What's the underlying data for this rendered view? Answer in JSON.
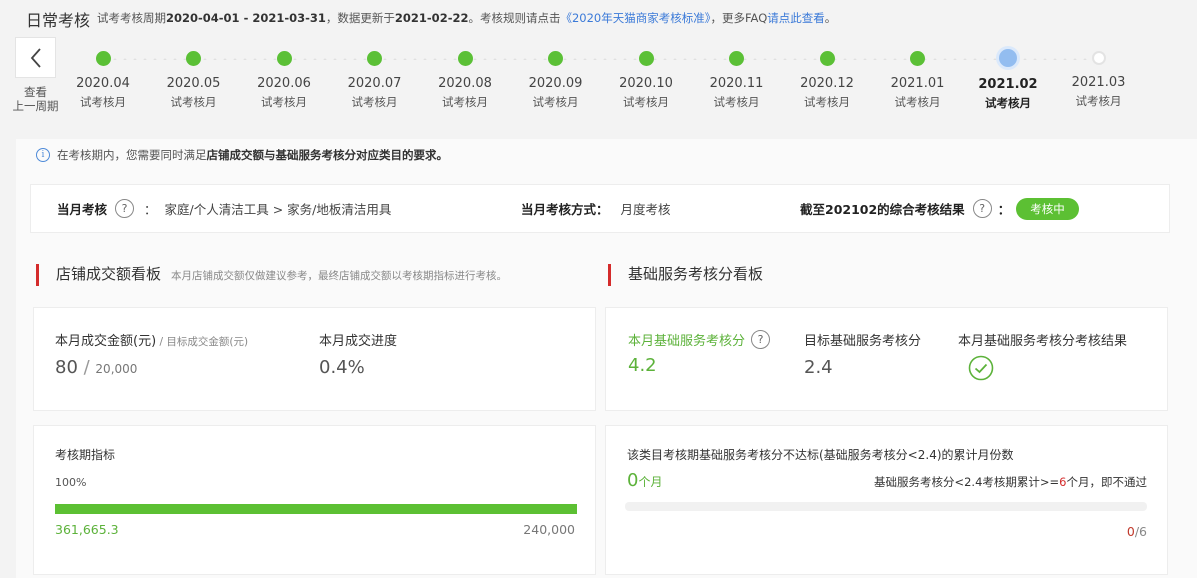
{
  "header": {
    "title": "日常考核",
    "sub_prefix": "试考考核周期",
    "period_range": "2020-04-01 - 2021-03-31",
    "sub_mid": "，数据更新于",
    "update_date": "2021-02-22",
    "sub_rule": "。考核规则请点击",
    "rule_link": "《2020年天猫商家考核标准》",
    "sub_faq": "，更多FAQ",
    "faq_link": "请点此查看",
    "sub_end": "。"
  },
  "timeline": {
    "prev_label_1": "查看",
    "prev_label_2": "上一周期",
    "periods": [
      {
        "date": "2020.04",
        "label": "试考核月",
        "status": "done"
      },
      {
        "date": "2020.05",
        "label": "试考核月",
        "status": "done"
      },
      {
        "date": "2020.06",
        "label": "试考核月",
        "status": "done"
      },
      {
        "date": "2020.07",
        "label": "试考核月",
        "status": "done"
      },
      {
        "date": "2020.08",
        "label": "试考核月",
        "status": "done"
      },
      {
        "date": "2020.09",
        "label": "试考核月",
        "status": "done"
      },
      {
        "date": "2020.10",
        "label": "试考核月",
        "status": "done"
      },
      {
        "date": "2020.11",
        "label": "试考核月",
        "status": "done"
      },
      {
        "date": "2020.12",
        "label": "试考核月",
        "status": "done"
      },
      {
        "date": "2021.01",
        "label": "试考核月",
        "status": "done"
      },
      {
        "date": "2021.02",
        "label": "试考核月",
        "status": "current"
      },
      {
        "date": "2021.03",
        "label": "试考核月",
        "status": "future"
      }
    ]
  },
  "notice": {
    "prefix": "在考核期内，您需要同时满足",
    "bold": "店铺成交额与基础服务考核分对应类目的要求。"
  },
  "summary": {
    "month_label": "当月考核",
    "category": "家庭/个人清洁工具 > 家务/地板清洁用具",
    "method_label": "当月考核方式：",
    "method_value": "月度考核",
    "result_label": "截至202102的综合考核结果",
    "result_suffix": "：",
    "result_badge": "考核中"
  },
  "sales": {
    "title": "店铺成交额看板",
    "note": "本月店铺成交额仅做建议参考，最终店铺成交额以考核期指标进行考核。",
    "amount_label": "本月成交金额(元)",
    "target_label": " / 目标成交金额(元)",
    "amount_value": "80",
    "slash": " / ",
    "target_value": "20,000",
    "progress_label": "本月成交进度",
    "progress_value": "0.4%",
    "period_label": "考核期指标",
    "period_percent": "100%",
    "period_progress": 1.0,
    "period_current": "361,665.3",
    "period_target": "240,000"
  },
  "service": {
    "title": "基础服务考核分看板",
    "score_label": "本月基础服务考核分",
    "score_value": "4.2",
    "target_label": "目标基础服务考核分",
    "target_value": "2.4",
    "result_label": "本月基础服务考核分考核结果",
    "fail_desc": "该类目考核期基础服务考核分不达标(基础服务考核分<2.4)的累计月份数",
    "fail_count": "0",
    "fail_unit": "个月",
    "rule_prefix": "基础服务考核分<2.4考核期累计>=",
    "rule_num": "6",
    "rule_suffix": "个月，即不通过",
    "ratio_current": "0",
    "ratio_total": "/6"
  },
  "colors": {
    "green": "#5cc033",
    "accent_red": "#d42b2b",
    "link_blue": "#3b7ad8"
  }
}
